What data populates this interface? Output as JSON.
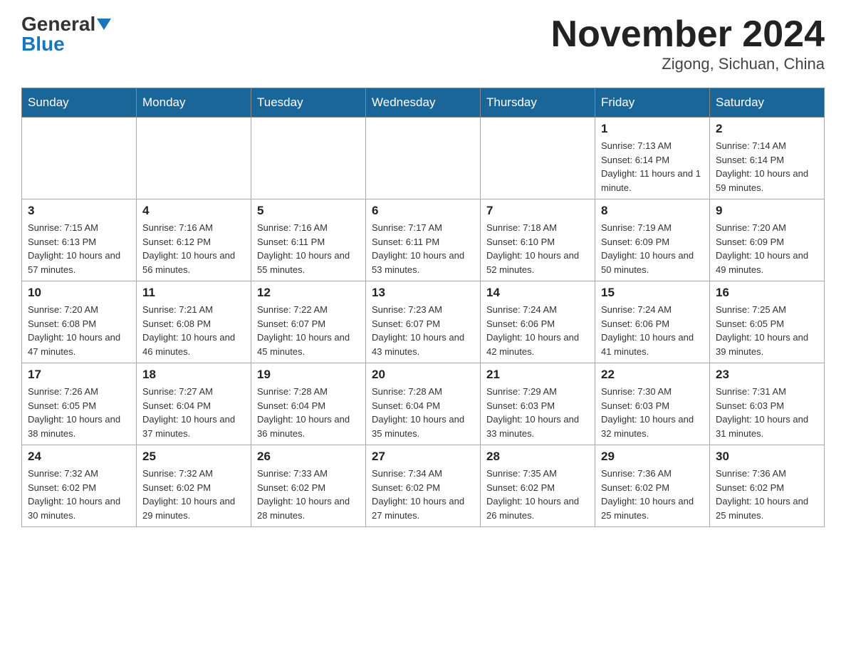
{
  "header": {
    "logo_general": "General",
    "logo_blue": "Blue",
    "month_title": "November 2024",
    "location": "Zigong, Sichuan, China"
  },
  "weekdays": [
    "Sunday",
    "Monday",
    "Tuesday",
    "Wednesday",
    "Thursday",
    "Friday",
    "Saturday"
  ],
  "weeks": [
    [
      {
        "day": "",
        "info": ""
      },
      {
        "day": "",
        "info": ""
      },
      {
        "day": "",
        "info": ""
      },
      {
        "day": "",
        "info": ""
      },
      {
        "day": "",
        "info": ""
      },
      {
        "day": "1",
        "info": "Sunrise: 7:13 AM\nSunset: 6:14 PM\nDaylight: 11 hours and 1 minute."
      },
      {
        "day": "2",
        "info": "Sunrise: 7:14 AM\nSunset: 6:14 PM\nDaylight: 10 hours and 59 minutes."
      }
    ],
    [
      {
        "day": "3",
        "info": "Sunrise: 7:15 AM\nSunset: 6:13 PM\nDaylight: 10 hours and 57 minutes."
      },
      {
        "day": "4",
        "info": "Sunrise: 7:16 AM\nSunset: 6:12 PM\nDaylight: 10 hours and 56 minutes."
      },
      {
        "day": "5",
        "info": "Sunrise: 7:16 AM\nSunset: 6:11 PM\nDaylight: 10 hours and 55 minutes."
      },
      {
        "day": "6",
        "info": "Sunrise: 7:17 AM\nSunset: 6:11 PM\nDaylight: 10 hours and 53 minutes."
      },
      {
        "day": "7",
        "info": "Sunrise: 7:18 AM\nSunset: 6:10 PM\nDaylight: 10 hours and 52 minutes."
      },
      {
        "day": "8",
        "info": "Sunrise: 7:19 AM\nSunset: 6:09 PM\nDaylight: 10 hours and 50 minutes."
      },
      {
        "day": "9",
        "info": "Sunrise: 7:20 AM\nSunset: 6:09 PM\nDaylight: 10 hours and 49 minutes."
      }
    ],
    [
      {
        "day": "10",
        "info": "Sunrise: 7:20 AM\nSunset: 6:08 PM\nDaylight: 10 hours and 47 minutes."
      },
      {
        "day": "11",
        "info": "Sunrise: 7:21 AM\nSunset: 6:08 PM\nDaylight: 10 hours and 46 minutes."
      },
      {
        "day": "12",
        "info": "Sunrise: 7:22 AM\nSunset: 6:07 PM\nDaylight: 10 hours and 45 minutes."
      },
      {
        "day": "13",
        "info": "Sunrise: 7:23 AM\nSunset: 6:07 PM\nDaylight: 10 hours and 43 minutes."
      },
      {
        "day": "14",
        "info": "Sunrise: 7:24 AM\nSunset: 6:06 PM\nDaylight: 10 hours and 42 minutes."
      },
      {
        "day": "15",
        "info": "Sunrise: 7:24 AM\nSunset: 6:06 PM\nDaylight: 10 hours and 41 minutes."
      },
      {
        "day": "16",
        "info": "Sunrise: 7:25 AM\nSunset: 6:05 PM\nDaylight: 10 hours and 39 minutes."
      }
    ],
    [
      {
        "day": "17",
        "info": "Sunrise: 7:26 AM\nSunset: 6:05 PM\nDaylight: 10 hours and 38 minutes."
      },
      {
        "day": "18",
        "info": "Sunrise: 7:27 AM\nSunset: 6:04 PM\nDaylight: 10 hours and 37 minutes."
      },
      {
        "day": "19",
        "info": "Sunrise: 7:28 AM\nSunset: 6:04 PM\nDaylight: 10 hours and 36 minutes."
      },
      {
        "day": "20",
        "info": "Sunrise: 7:28 AM\nSunset: 6:04 PM\nDaylight: 10 hours and 35 minutes."
      },
      {
        "day": "21",
        "info": "Sunrise: 7:29 AM\nSunset: 6:03 PM\nDaylight: 10 hours and 33 minutes."
      },
      {
        "day": "22",
        "info": "Sunrise: 7:30 AM\nSunset: 6:03 PM\nDaylight: 10 hours and 32 minutes."
      },
      {
        "day": "23",
        "info": "Sunrise: 7:31 AM\nSunset: 6:03 PM\nDaylight: 10 hours and 31 minutes."
      }
    ],
    [
      {
        "day": "24",
        "info": "Sunrise: 7:32 AM\nSunset: 6:02 PM\nDaylight: 10 hours and 30 minutes."
      },
      {
        "day": "25",
        "info": "Sunrise: 7:32 AM\nSunset: 6:02 PM\nDaylight: 10 hours and 29 minutes."
      },
      {
        "day": "26",
        "info": "Sunrise: 7:33 AM\nSunset: 6:02 PM\nDaylight: 10 hours and 28 minutes."
      },
      {
        "day": "27",
        "info": "Sunrise: 7:34 AM\nSunset: 6:02 PM\nDaylight: 10 hours and 27 minutes."
      },
      {
        "day": "28",
        "info": "Sunrise: 7:35 AM\nSunset: 6:02 PM\nDaylight: 10 hours and 26 minutes."
      },
      {
        "day": "29",
        "info": "Sunrise: 7:36 AM\nSunset: 6:02 PM\nDaylight: 10 hours and 25 minutes."
      },
      {
        "day": "30",
        "info": "Sunrise: 7:36 AM\nSunset: 6:02 PM\nDaylight: 10 hours and 25 minutes."
      }
    ]
  ]
}
